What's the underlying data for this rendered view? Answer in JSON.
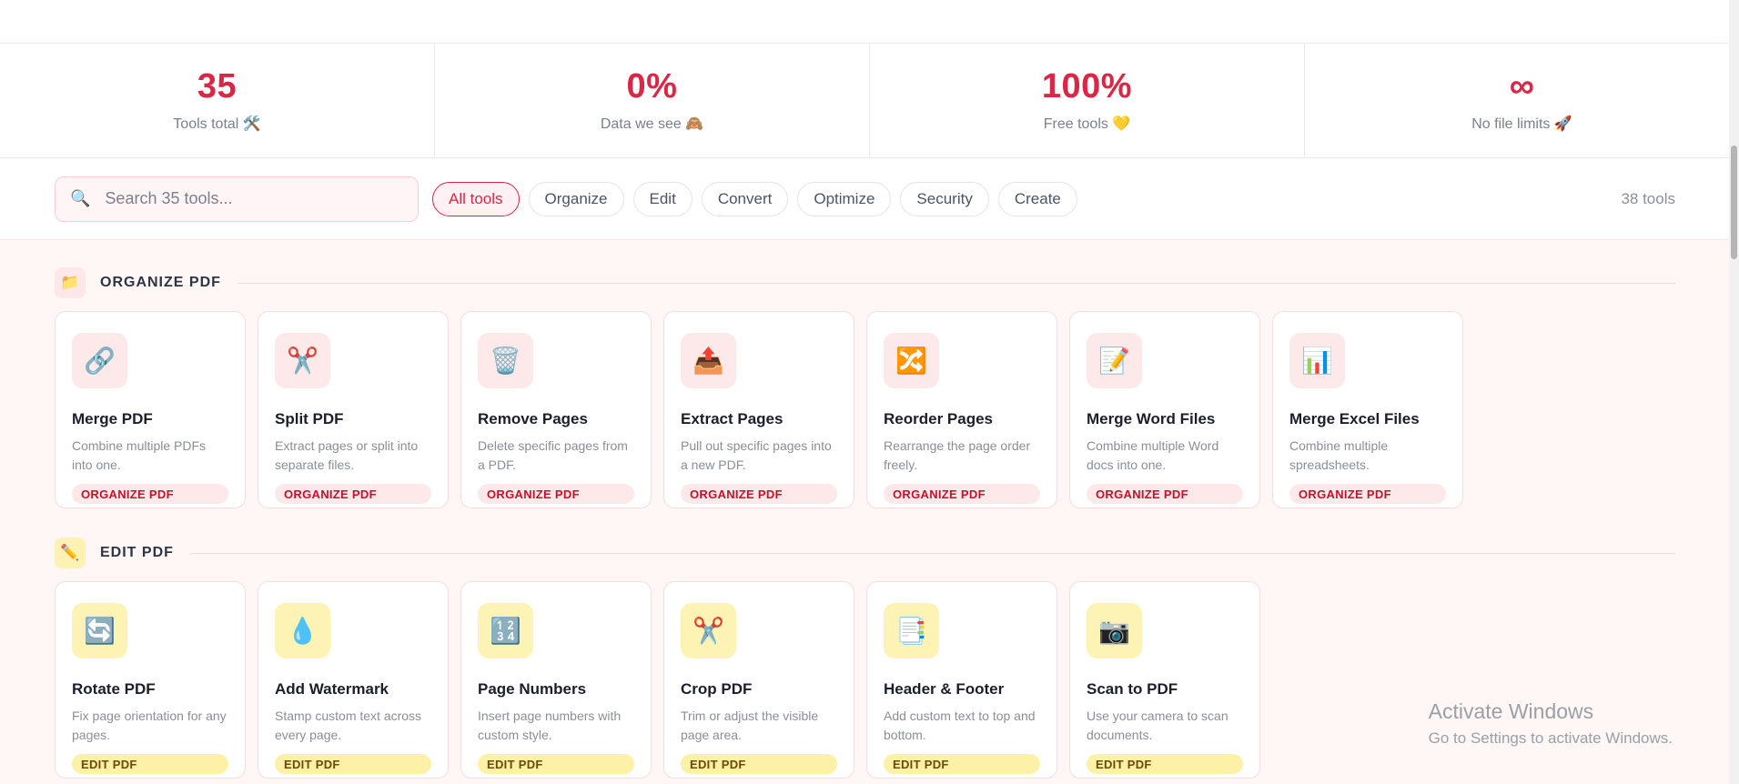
{
  "stats": [
    {
      "value": "35",
      "label": "Tools total 🛠️"
    },
    {
      "value": "0%",
      "label": "Data we see 🙈"
    },
    {
      "value": "100%",
      "label": "Free tools 💛"
    },
    {
      "value": "∞",
      "label": "No file limits 🚀"
    }
  ],
  "search": {
    "placeholder": "Search 35 tools..."
  },
  "filters": [
    "All tools",
    "Organize",
    "Edit",
    "Convert",
    "Optimize",
    "Security",
    "Create"
  ],
  "tools_count": "38 tools",
  "sections": {
    "organize": {
      "title": "ORGANIZE PDF",
      "icon": "📁",
      "tag": "ORGANIZE PDF",
      "cards": [
        {
          "icon": "🔗",
          "title": "Merge PDF",
          "desc": "Combine multiple PDFs into one."
        },
        {
          "icon": "✂️",
          "title": "Split PDF",
          "desc": "Extract pages or split into separate files."
        },
        {
          "icon": "🗑️",
          "title": "Remove Pages",
          "desc": "Delete specific pages from a PDF."
        },
        {
          "icon": "📤",
          "title": "Extract Pages",
          "desc": "Pull out specific pages into a new PDF."
        },
        {
          "icon": "🔀",
          "title": "Reorder Pages",
          "desc": "Rearrange the page order freely."
        },
        {
          "icon": "📝",
          "title": "Merge Word Files",
          "desc": "Combine multiple Word docs into one."
        },
        {
          "icon": "📊",
          "title": "Merge Excel Files",
          "desc": "Combine multiple spreadsheets."
        }
      ]
    },
    "edit": {
      "title": "EDIT PDF",
      "icon": "✏️",
      "tag": "EDIT PDF",
      "cards": [
        {
          "icon": "🔄",
          "title": "Rotate PDF",
          "desc": "Fix page orientation for any pages."
        },
        {
          "icon": "💧",
          "title": "Add Watermark",
          "desc": "Stamp custom text across every page."
        },
        {
          "icon": "🔢",
          "title": "Page Numbers",
          "desc": "Insert page numbers with custom style."
        },
        {
          "icon": "✂️",
          "title": "Crop PDF",
          "desc": "Trim or adjust the visible page area."
        },
        {
          "icon": "📑",
          "title": "Header & Footer",
          "desc": "Add custom text to top and bottom."
        },
        {
          "icon": "📷",
          "title": "Scan to PDF",
          "desc": "Use your camera to scan documents."
        }
      ]
    }
  },
  "watermark": {
    "title": "Activate Windows",
    "subtitle": "Go to Settings to activate Windows."
  },
  "colors": {
    "accent": "#dc2645",
    "organize_tag": "#c8102e",
    "edit_tag_bg": "#fdf1a8"
  }
}
